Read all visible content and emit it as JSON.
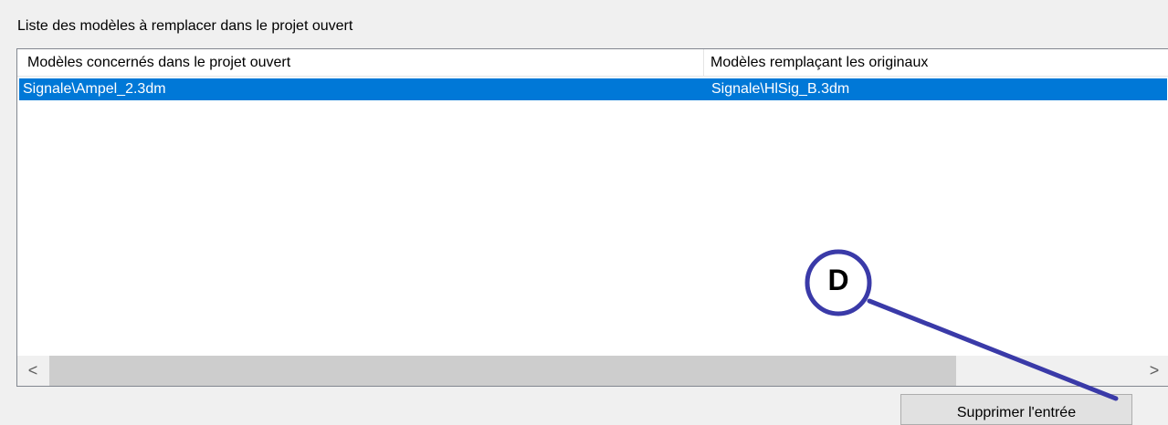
{
  "group_label": "Liste des modèles à remplacer dans le projet ouvert",
  "table": {
    "columns": [
      "Modèles concernés dans le projet ouvert",
      "Modèles remplaçant les originaux"
    ],
    "rows": [
      [
        "Signale\\Ampel_2.3dm",
        "Signale\\HlSig_B.3dm"
      ]
    ],
    "selected_row": 0
  },
  "scrollbar": {
    "left_arrow": "<",
    "right_arrow": ">"
  },
  "button": {
    "delete_entry": "Supprimer l'entrée"
  },
  "callout": {
    "label": "D",
    "color": "#3a3aa8"
  },
  "colors": {
    "selection": "#0078d7",
    "window_bg": "#f0f0f0"
  }
}
